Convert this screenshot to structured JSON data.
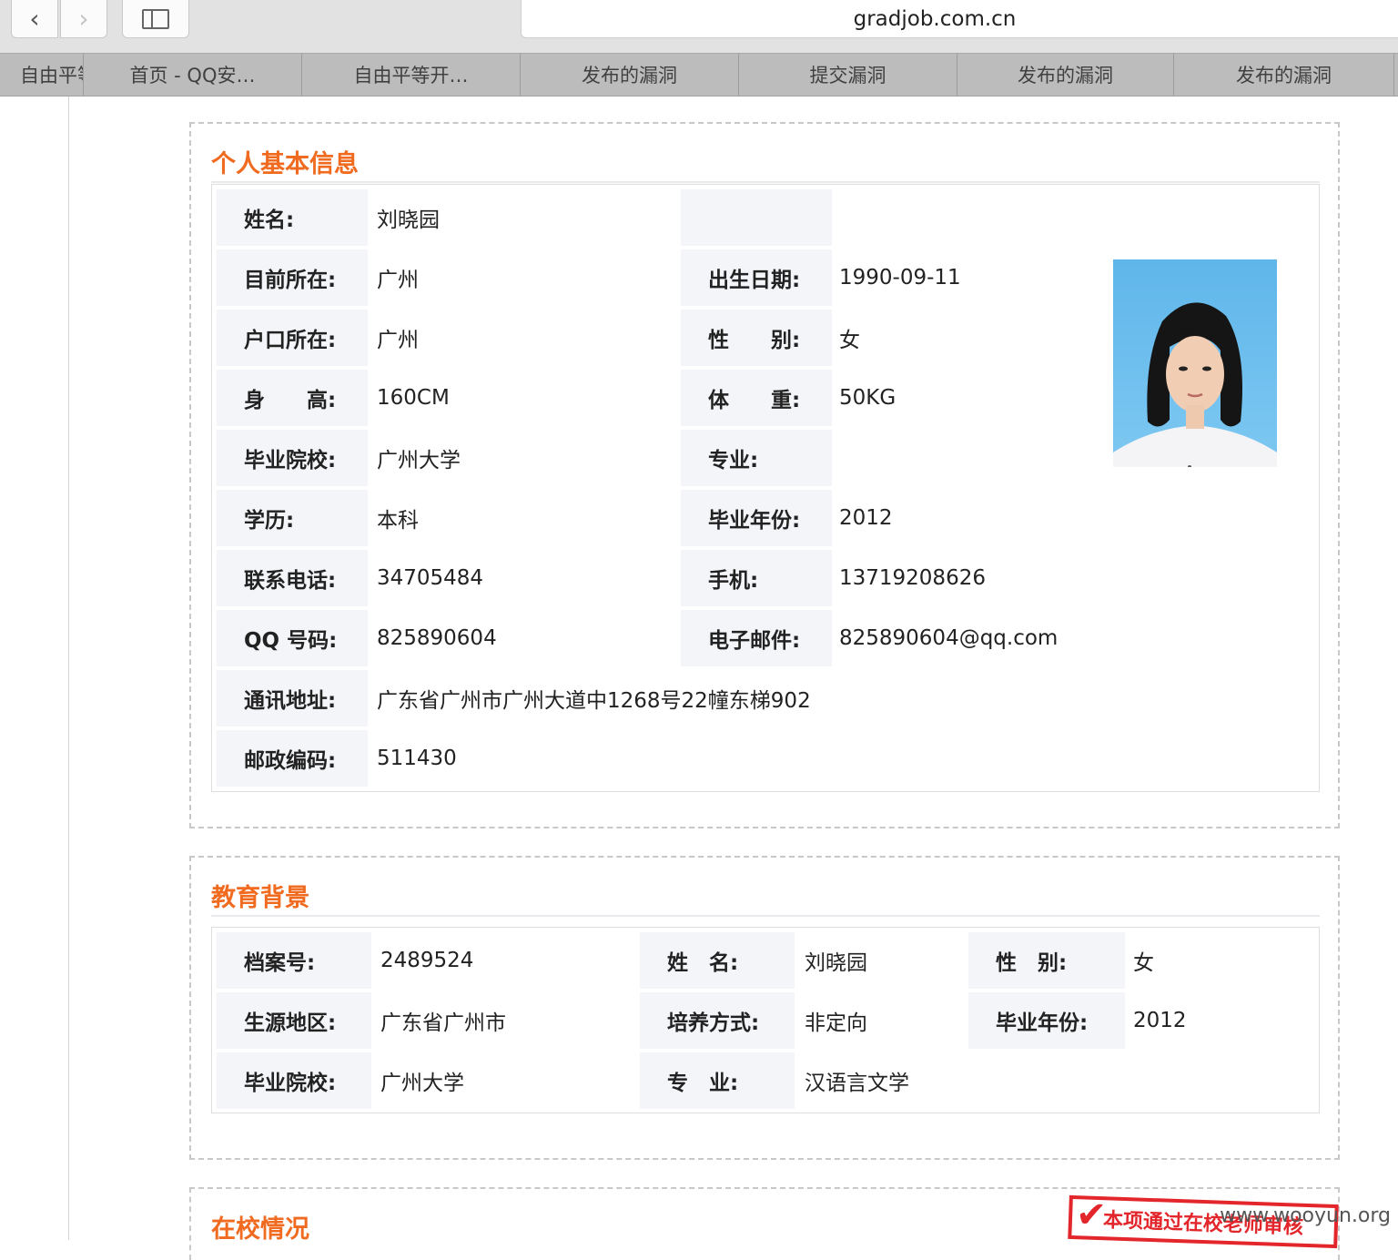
{
  "browser": {
    "back_glyph": "‹",
    "forward_glyph": "›",
    "url": "gradjob.com.cn",
    "tabs": [
      "自由平等开…",
      "首页 - QQ安…",
      "自由平等开…",
      "发布的漏洞",
      "提交漏洞",
      "发布的漏洞",
      "发布的漏洞"
    ]
  },
  "basic_info": {
    "title": "个人基本信息",
    "rows": [
      {
        "l1": "姓名:",
        "v1": "刘晓园",
        "l2": "",
        "v2": ""
      },
      {
        "l1": "目前所在:",
        "v1": "广州",
        "l2": "出生日期:",
        "v2": "1990-09-11"
      },
      {
        "l1": "户口所在:",
        "v1": "广州",
        "l2": "性　　别:",
        "v2": "女"
      },
      {
        "l1": "身　　高:",
        "v1": "160CM",
        "l2": "体　　重:",
        "v2": "50KG"
      },
      {
        "l1": "毕业院校:",
        "v1": "广州大学",
        "l2": "专业:",
        "v2": ""
      },
      {
        "l1": "学历:",
        "v1": "本科",
        "l2": "毕业年份:",
        "v2": "2012"
      },
      {
        "l1": "联系电话:",
        "v1": "34705484",
        "l2": "手机:",
        "v2": "13719208626"
      },
      {
        "l1": "QQ 号码:",
        "v1": "825890604",
        "l2": "电子邮件:",
        "v2": "825890604@qq.com"
      },
      {
        "l1": "通讯地址:",
        "v1": "广东省广州市广州大道中1268号22幢东梯902"
      },
      {
        "l1": "邮政编码:",
        "v1": "511430"
      }
    ]
  },
  "education": {
    "title": "教育背景",
    "rows": [
      {
        "l1": "档案号:",
        "v1": "2489524",
        "l2": "姓　名:",
        "v2": "刘晓园",
        "l3": "性　别:",
        "v3": "女"
      },
      {
        "l1": "生源地区:",
        "v1": "广东省广州市",
        "l2": "培养方式:",
        "v2": "非定向",
        "l3": "毕业年份:",
        "v3": "2012"
      },
      {
        "l1": "毕业院校:",
        "v1": "广州大学",
        "l2": "专　业:",
        "v2": "汉语言文学"
      }
    ]
  },
  "school_section": {
    "title": "在校情况"
  },
  "stamp_text": "本项通过在校老师审核",
  "watermark": "www.wooyun.org",
  "colors": {
    "section_title": "#f06a1f",
    "label_bg": "#f3f5f8",
    "stamp": "#e3262b"
  }
}
